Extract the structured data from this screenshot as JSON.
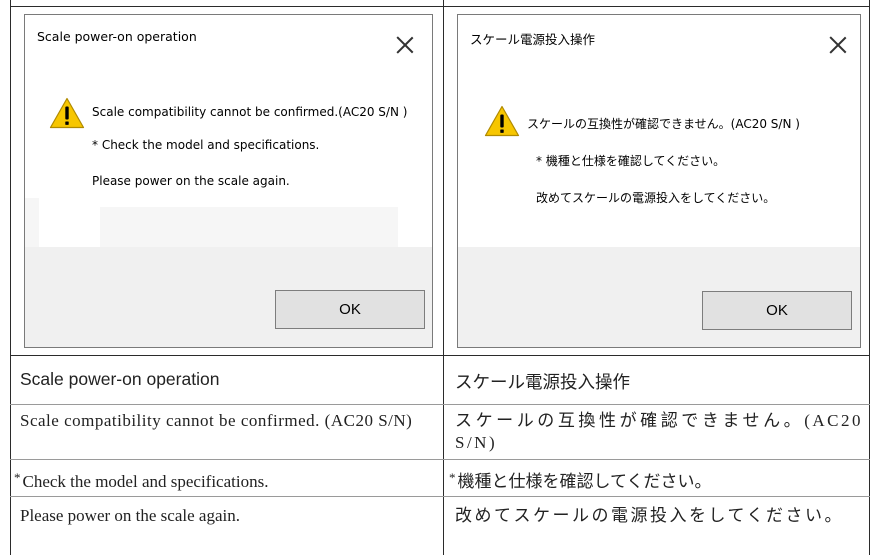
{
  "left_column": {
    "dialog": {
      "title": "Scale power-on operation",
      "message": "Scale compatibility cannot be confirmed.(AC20 S/N )",
      "note": "* Check the model and specifications.",
      "instruction": "Please power on the scale again.",
      "ok_label": "OK"
    },
    "caption": {
      "title": "Scale power-on operation",
      "message": "Scale compatibility cannot be confirmed. (AC20 S/N)",
      "note_mark": "*",
      "note": "Check the model and specifications.",
      "instruction": "Please power on the scale again."
    }
  },
  "right_column": {
    "dialog": {
      "title": "スケール電源投入操作",
      "message": "スケールの互換性が確認できません。(AC20 S/N )",
      "note": "* 機種と仕様を確認してください。",
      "instruction": "改めてスケールの電源投入をしてください。",
      "ok_label": "OK"
    },
    "caption": {
      "title": "スケール電源投入操作",
      "message": "スケールの互換性が確認できません。(AC20 S/N)",
      "note_mark": "*",
      "note": "機種と仕様を確認してください。",
      "instruction": "改めてスケールの電源投入をしてください。"
    }
  },
  "icons": {
    "close": "close-icon",
    "warning": "warning-icon"
  },
  "colors": {
    "warning_yellow": "#f7c600",
    "footer_gray": "#f0f0f0",
    "button_gray": "#e1e1e1",
    "button_border": "#7d7d7d"
  }
}
